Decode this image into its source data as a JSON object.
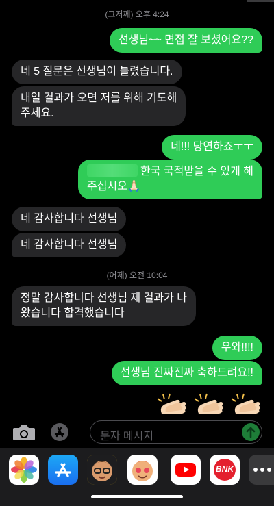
{
  "timestamps": [
    {
      "text": "(그저께) 오후 4:24"
    },
    {
      "text": "(어제) 오전 10:04"
    }
  ],
  "messages": [
    {
      "dir": "out",
      "text": "선생님~~ 면접 잘 보셨어요??"
    },
    {
      "dir": "in",
      "text": "네 5 질문은 선생님이 틀렸습니다."
    },
    {
      "dir": "in",
      "line1": "내일 결과가 오면 저를 위해 기도해",
      "line2": "주세요."
    },
    {
      "dir": "out",
      "text": "네!!! 당연하죠ㅜㅜ"
    },
    {
      "dir": "out",
      "line1_visible": "한국 국적받을 수 있게 해",
      "line2": "주십시오🙏🏻"
    },
    {
      "dir": "in",
      "text": "네 감사합니다 선생님"
    },
    {
      "dir": "in",
      "text": "네 감사합니다 선생님"
    },
    {
      "dir": "in",
      "line1": "정말 감사합니다 선생님 제 결과가 나",
      "line2": "왔습니다 합격했습니다"
    },
    {
      "dir": "out",
      "text": "우와!!!!"
    },
    {
      "dir": "out",
      "text": "선생님 진짜진짜 축하드려요!!"
    }
  ],
  "reaction_emoji": "clapping-hands x3",
  "composer": {
    "placeholder": "문자 메시지",
    "camera_icon": "camera-icon",
    "apps_icon": "app-store-icon",
    "send_icon": "send-arrow-icon"
  },
  "dock": {
    "apps": [
      {
        "name": "photos-app"
      },
      {
        "name": "app-store-app"
      },
      {
        "name": "memoji-app"
      },
      {
        "name": "animoji-app"
      },
      {
        "name": "youtube-app"
      },
      {
        "name": "bnk-app",
        "label": "BNK"
      },
      {
        "name": "more-apps"
      }
    ]
  },
  "colors": {
    "incoming": "#262628",
    "outgoing": "#2fcc57",
    "background": "#000000"
  }
}
